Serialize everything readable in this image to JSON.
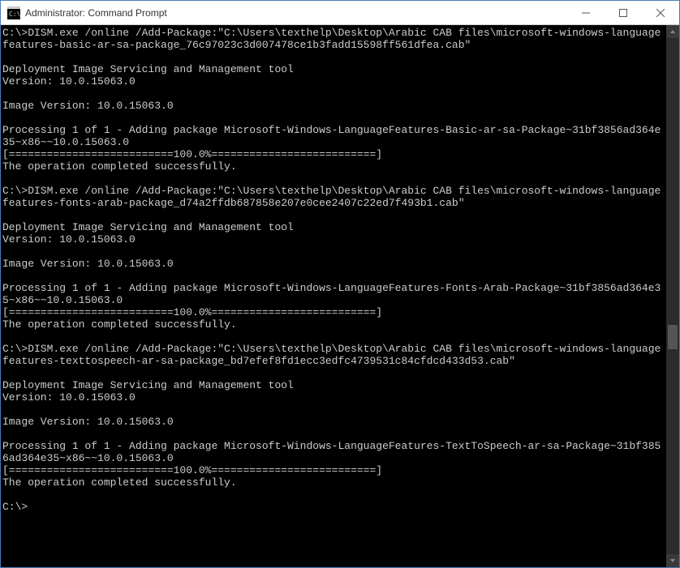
{
  "window": {
    "title": "Administrator: Command Prompt"
  },
  "terminal": {
    "lines": [
      "C:\\>DISM.exe /online /Add-Package:\"C:\\Users\\texthelp\\Desktop\\Arabic CAB files\\microsoft-windows-languagefeatures-basic-ar-sa-package_76c97023c3d007478ce1b3fadd15598ff561dfea.cab\"",
      "",
      "Deployment Image Servicing and Management tool",
      "Version: 10.0.15063.0",
      "",
      "Image Version: 10.0.15063.0",
      "",
      "Processing 1 of 1 - Adding package Microsoft-Windows-LanguageFeatures-Basic-ar-sa-Package~31bf3856ad364e35~x86~~10.0.15063.0",
      "[==========================100.0%==========================]",
      "The operation completed successfully.",
      "",
      "C:\\>DISM.exe /online /Add-Package:\"C:\\Users\\texthelp\\Desktop\\Arabic CAB files\\microsoft-windows-languagefeatures-fonts-arab-package_d74a2ffdb687858e207e0cee2407c22ed7f493b1.cab\"",
      "",
      "Deployment Image Servicing and Management tool",
      "Version: 10.0.15063.0",
      "",
      "Image Version: 10.0.15063.0",
      "",
      "Processing 1 of 1 - Adding package Microsoft-Windows-LanguageFeatures-Fonts-Arab-Package~31bf3856ad364e35~x86~~10.0.15063.0",
      "[==========================100.0%==========================]",
      "The operation completed successfully.",
      "",
      "C:\\>DISM.exe /online /Add-Package:\"C:\\Users\\texthelp\\Desktop\\Arabic CAB files\\microsoft-windows-languagefeatures-texttospeech-ar-sa-package_bd7efef8fd1ecc3edfc4739531c84cfdcd433d53.cab\"",
      "",
      "Deployment Image Servicing and Management tool",
      "Version: 10.0.15063.0",
      "",
      "Image Version: 10.0.15063.0",
      "",
      "Processing 1 of 1 - Adding package Microsoft-Windows-LanguageFeatures-TextToSpeech-ar-sa-Package~31bf3856ad364e35~x86~~10.0.15063.0",
      "[==========================100.0%==========================]",
      "The operation completed successfully.",
      "",
      "C:\\>"
    ]
  }
}
